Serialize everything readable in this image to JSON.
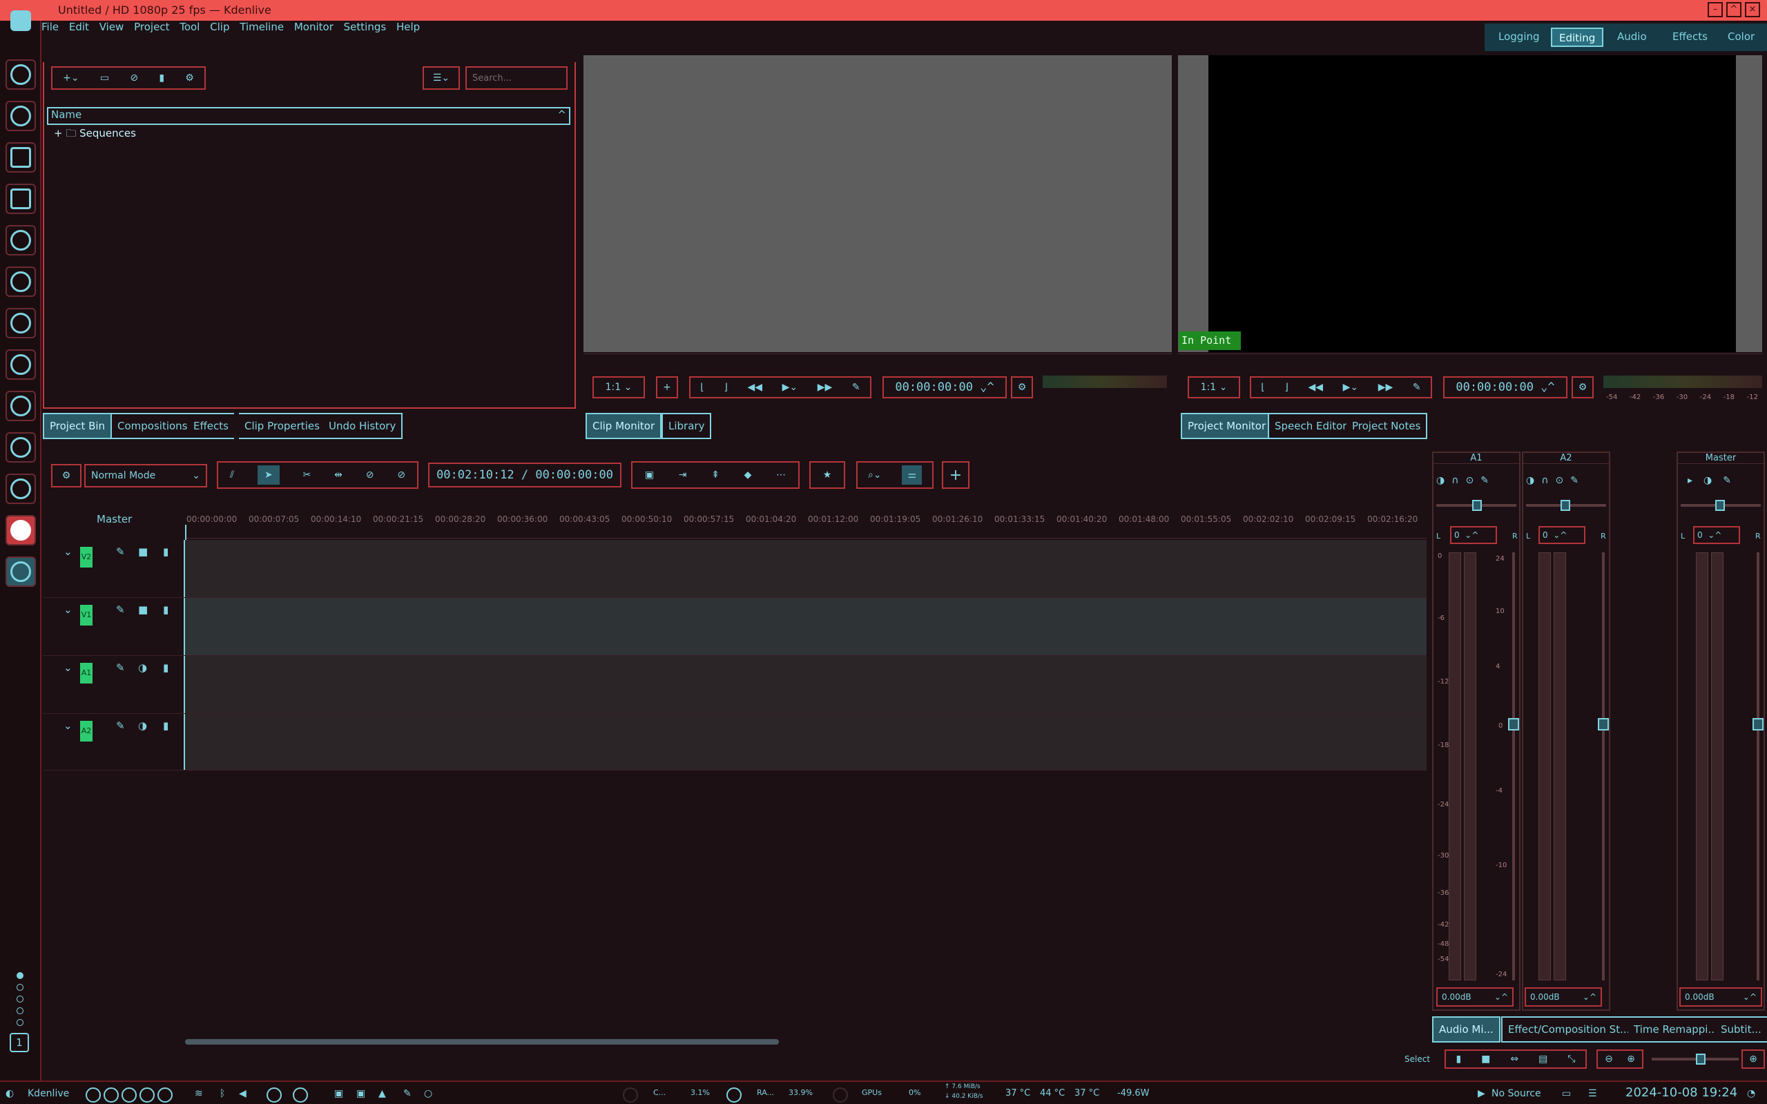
{
  "window": {
    "title": "Untitled / HD 1080p 25 fps — Kdenlive"
  },
  "menu": [
    "File",
    "Edit",
    "View",
    "Project",
    "Tool",
    "Clip",
    "Timeline",
    "Monitor",
    "Settings",
    "Help"
  ],
  "workspaces": [
    "Logging",
    "Editing",
    "Audio",
    "Effects",
    "Color"
  ],
  "workspace_active": "Editing",
  "bin": {
    "search_placeholder": "Search...",
    "column": "Name",
    "folder": "Sequences"
  },
  "bin_tabs": [
    "Project Bin",
    "Compositions",
    "Effects",
    "Clip Properties",
    "Undo History"
  ],
  "clip_monitor": {
    "zoom": "1:1",
    "timecode": "00:00:00:00"
  },
  "clip_tabs": [
    "Clip Monitor",
    "Library"
  ],
  "project_monitor": {
    "zoom": "1:1",
    "timecode": "00:00:00:00",
    "in_point": "In Point",
    "scale": [
      "-54",
      "-42",
      "-36",
      "-30",
      "-24",
      "-18",
      "-12"
    ]
  },
  "project_tabs": [
    "Project Monitor",
    "Speech Editor",
    "Project Notes"
  ],
  "timeline": {
    "mode": "Normal Mode",
    "timecode": "00:02:10:12 / 00:00:00:00",
    "master": "Master",
    "ruler": [
      "00:00:00:00",
      "00:00:07:05",
      "00:00:14:10",
      "00:00:21:15",
      "00:00:28:20",
      "00:00:36:00",
      "00:00:43:05",
      "00:00:50:10",
      "00:00:57:15",
      "00:01:04:20",
      "00:01:12:00",
      "00:01:19:05",
      "00:01:26:10",
      "00:01:33:15",
      "00:01:40:20",
      "00:01:48:00",
      "00:01:55:05",
      "00:02:02:10",
      "00:02:09:15",
      "00:02:16:20"
    ],
    "tracks": [
      "V2",
      "V1",
      "A1",
      "A2"
    ]
  },
  "mixer": {
    "channels": [
      "A1",
      "A2",
      "Master"
    ],
    "gain": "0.00dB",
    "pan": "0",
    "L": "L",
    "R": "R",
    "scale_left": [
      "0",
      "-6",
      "-12",
      "-18",
      "-24",
      "-30",
      "-36",
      "-42",
      "-48",
      "-54"
    ],
    "scale_right": [
      "24",
      "10",
      "4",
      "0",
      "-4",
      "-10",
      "-24"
    ]
  },
  "bottom_tabs": [
    "Audio Mi...",
    "Effect/Composition St...",
    "Time Remappi...",
    "Subtit..."
  ],
  "select_label": "Select",
  "taskbar": {
    "app": "Kdenlive",
    "cpu_label": "C...",
    "cpu": "3.1%",
    "ram_label": "RA...",
    "ram": "33.9%",
    "gpu_label": "GPUs",
    "gpu": "0%",
    "net_up": "7.6 MiB/s",
    "net_down": "40.2 KiB/s",
    "temp1": "37 °C",
    "temp2": "44 °C",
    "temp3": "37 °C",
    "power": "-49.6W",
    "source": "No Source",
    "datetime": "2024-10-08 19:24"
  },
  "pager": "1"
}
